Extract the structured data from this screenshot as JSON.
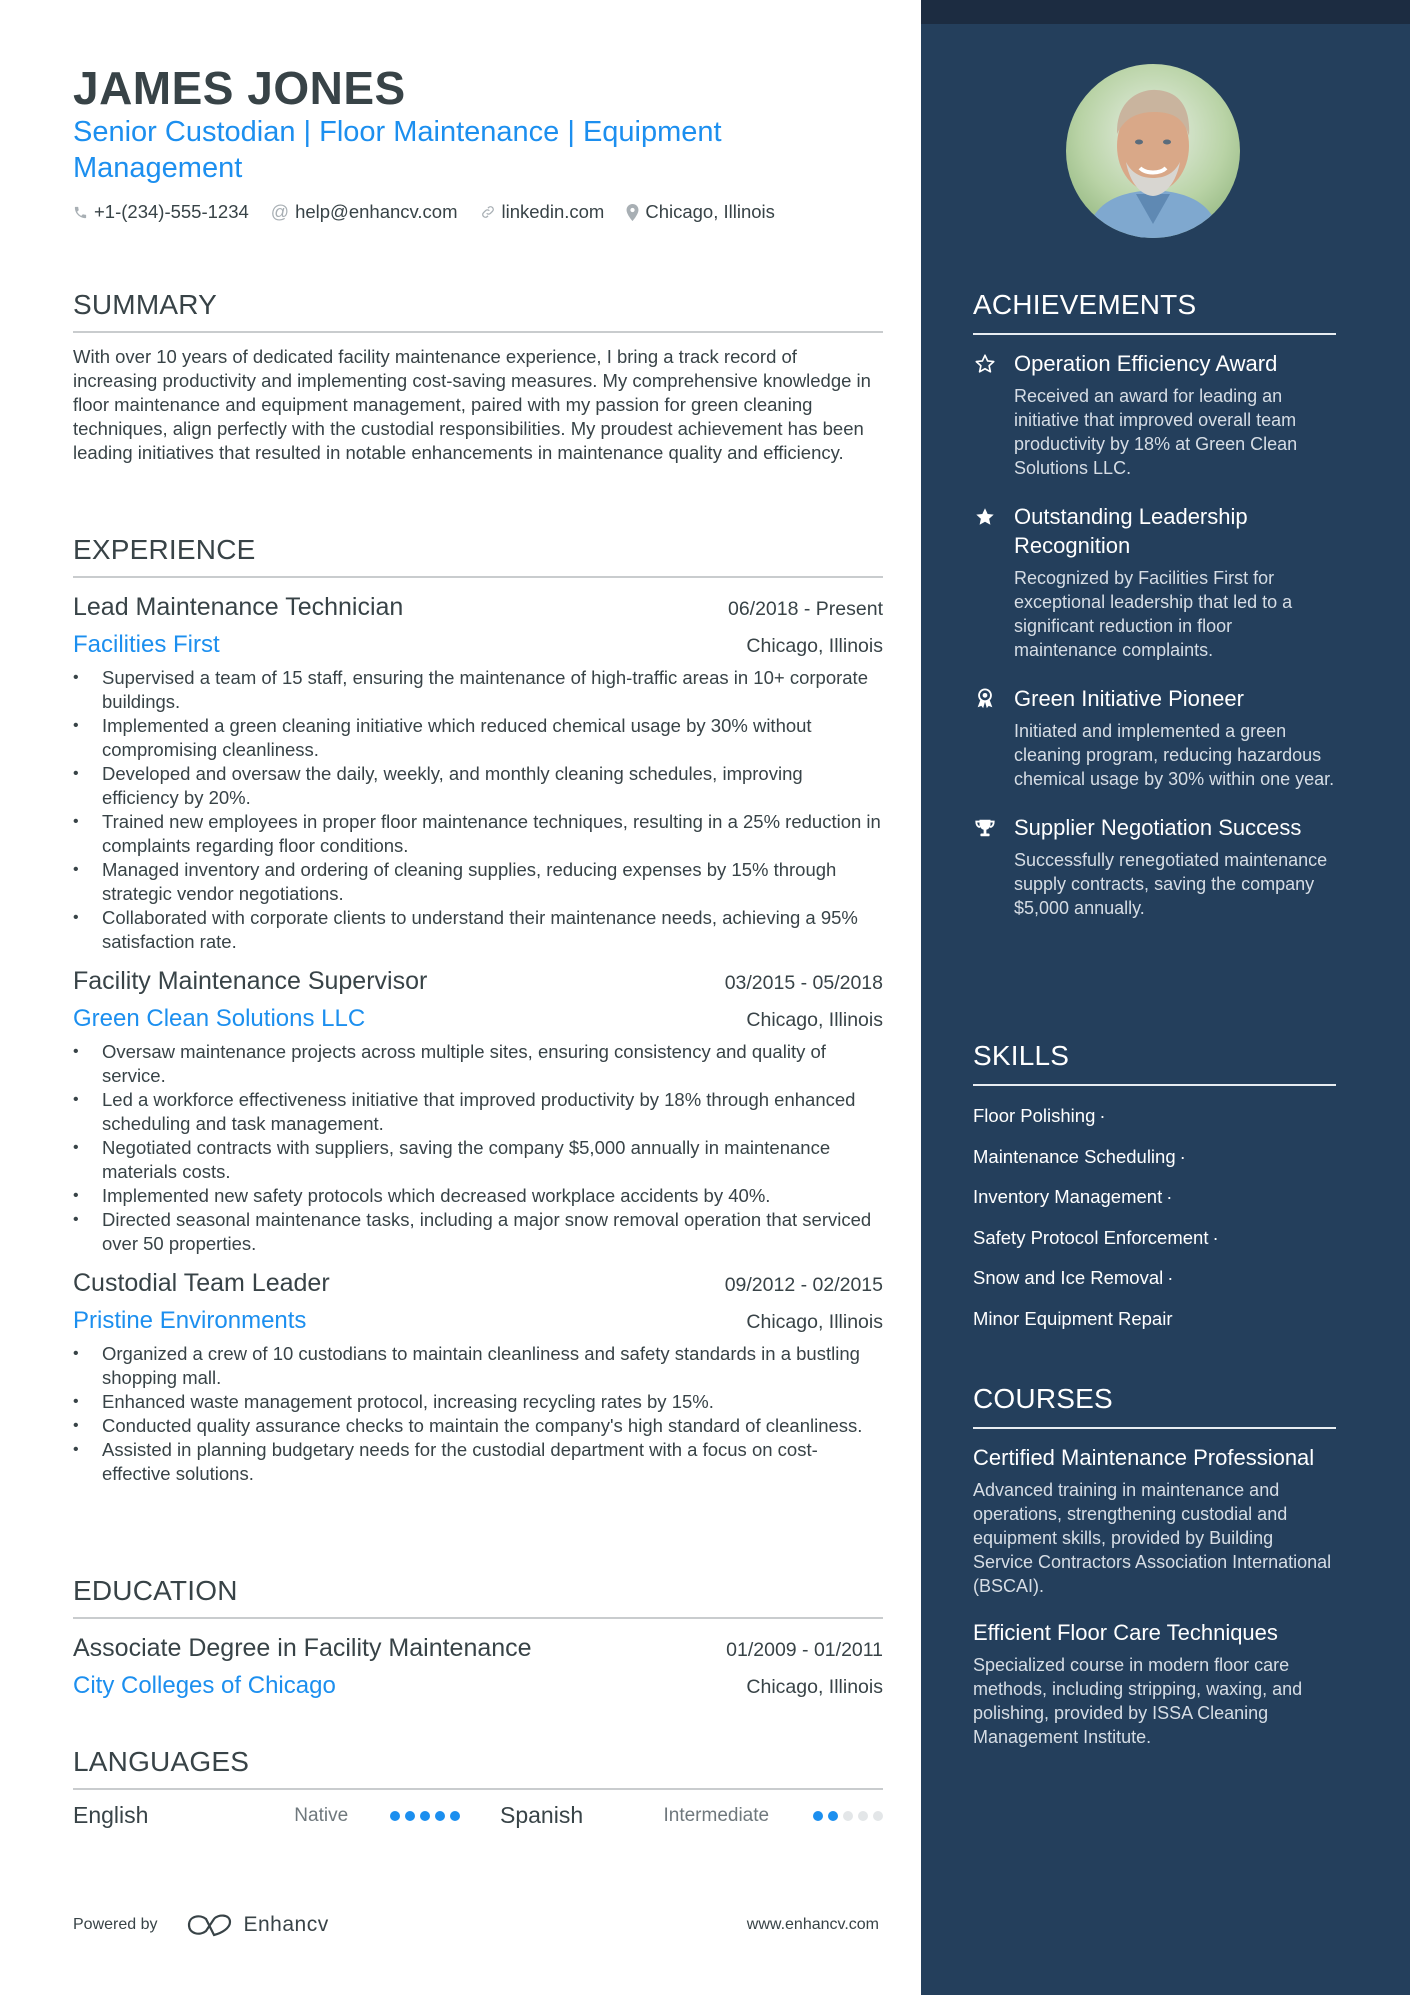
{
  "header": {
    "name": "JAMES JONES",
    "headline": "Senior Custodian | Floor Maintenance | Equipment Management",
    "contacts": [
      {
        "icon": "phone-icon",
        "text": "+1-(234)-555-1234"
      },
      {
        "icon": "at-icon",
        "text": "help@enhancv.com"
      },
      {
        "icon": "link-icon",
        "text": "linkedin.com"
      },
      {
        "icon": "location-pin-icon",
        "text": "Chicago, Illinois"
      }
    ]
  },
  "summary": {
    "heading": "SUMMARY",
    "text": "With over 10 years of dedicated facility maintenance experience, I bring a track record of increasing productivity and implementing cost-saving measures. My comprehensive knowledge in floor maintenance and equipment management, paired with my passion for green cleaning techniques, align perfectly with the custodial responsibilities. My proudest achievement has been leading initiatives that resulted in notable enhancements in maintenance quality and efficiency."
  },
  "experience": {
    "heading": "EXPERIENCE",
    "jobs": [
      {
        "title": "Lead Maintenance Technician",
        "dates": "06/2018 - Present",
        "company": "Facilities First",
        "location": "Chicago, Illinois",
        "bullets": [
          "Supervised a team of 15 staff, ensuring the maintenance of high-traffic areas in 10+ corporate buildings.",
          "Implemented a green cleaning initiative which reduced chemical usage by 30% without compromising cleanliness.",
          "Developed and oversaw the daily, weekly, and monthly cleaning schedules, improving efficiency by 20%.",
          "Trained new employees in proper floor maintenance techniques, resulting in a 25% reduction in complaints regarding floor conditions.",
          "Managed inventory and ordering of cleaning supplies, reducing expenses by 15% through strategic vendor negotiations.",
          "Collaborated with corporate clients to understand their maintenance needs, achieving a 95% satisfaction rate."
        ]
      },
      {
        "title": "Facility Maintenance Supervisor",
        "dates": "03/2015 - 05/2018",
        "company": "Green Clean Solutions LLC",
        "location": "Chicago, Illinois",
        "bullets": [
          "Oversaw maintenance projects across multiple sites, ensuring consistency and quality of service.",
          "Led a workforce effectiveness initiative that improved productivity by 18% through enhanced scheduling and task management.",
          "Negotiated contracts with suppliers, saving the company $5,000 annually in maintenance materials costs.",
          "Implemented new safety protocols which decreased workplace accidents by 40%.",
          "Directed seasonal maintenance tasks, including a major snow removal operation that serviced over 50 properties."
        ]
      },
      {
        "title": "Custodial Team Leader",
        "dates": "09/2012 - 02/2015",
        "company": "Pristine Environments",
        "location": "Chicago, Illinois",
        "bullets": [
          "Organized a crew of 10 custodians to maintain cleanliness and safety standards in a bustling shopping mall.",
          "Enhanced waste management protocol, increasing recycling rates by 15%.",
          "Conducted quality assurance checks to maintain the company's high standard of cleanliness.",
          "Assisted in planning budgetary needs for the custodial department with a focus on cost-effective solutions."
        ]
      }
    ]
  },
  "education": {
    "heading": "EDUCATION",
    "items": [
      {
        "degree": "Associate Degree in Facility Maintenance",
        "dates": "01/2009 - 01/2011",
        "school": "City Colleges of Chicago",
        "location": "Chicago, Illinois"
      }
    ]
  },
  "languages": {
    "heading": "LANGUAGES",
    "items": [
      {
        "name": "English",
        "level": "Native",
        "rating": 5,
        "max": 5
      },
      {
        "name": "Spanish",
        "level": "Intermediate",
        "rating": 2,
        "max": 5
      }
    ]
  },
  "footer": {
    "powered_by": "Powered by",
    "brand": "Enhancv",
    "url": "www.enhancv.com"
  },
  "sidebar": {
    "photo_alt": "Profile photo",
    "achievements": {
      "heading": "ACHIEVEMENTS",
      "items": [
        {
          "icon": "star-outline-icon",
          "title": "Operation Efficiency Award",
          "desc": "Received an award for leading an initiative that improved overall team productivity by 18% at Green Clean Solutions LLC."
        },
        {
          "icon": "star-filled-icon",
          "title": "Outstanding Leadership Recognition",
          "desc": "Recognized by Facilities First for exceptional leadership that led to a significant reduction in floor maintenance complaints."
        },
        {
          "icon": "award-ribbon-icon",
          "title": "Green Initiative Pioneer",
          "desc": "Initiated and implemented a green cleaning program, reducing hazardous chemical usage by 30% within one year."
        },
        {
          "icon": "trophy-icon",
          "title": "Supplier Negotiation Success",
          "desc": "Successfully renegotiated maintenance supply contracts, saving the company $5,000 annually."
        }
      ]
    },
    "skills": {
      "heading": "SKILLS",
      "items": [
        "Floor Polishing",
        "Maintenance Scheduling",
        "Inventory Management",
        "Safety Protocol Enforcement",
        "Snow and Ice Removal",
        "Minor Equipment Repair"
      ],
      "separator": "·"
    },
    "courses": {
      "heading": "COURSES",
      "items": [
        {
          "title": "Certified Maintenance Professional",
          "desc": "Advanced training in maintenance and operations, strengthening custodial and equipment skills, provided by Building Service Contractors Association International (BSCAI)."
        },
        {
          "title": "Efficient Floor Care Techniques",
          "desc": "Specialized course in modern floor care methods, including stripping, waxing, and polishing, provided by ISSA Cleaning Management Institute."
        }
      ]
    }
  },
  "colors": {
    "accent": "#1c8fef",
    "sidebar_bg": "#243f5c",
    "sidebar_top": "#1c2c41",
    "text": "#384347"
  }
}
